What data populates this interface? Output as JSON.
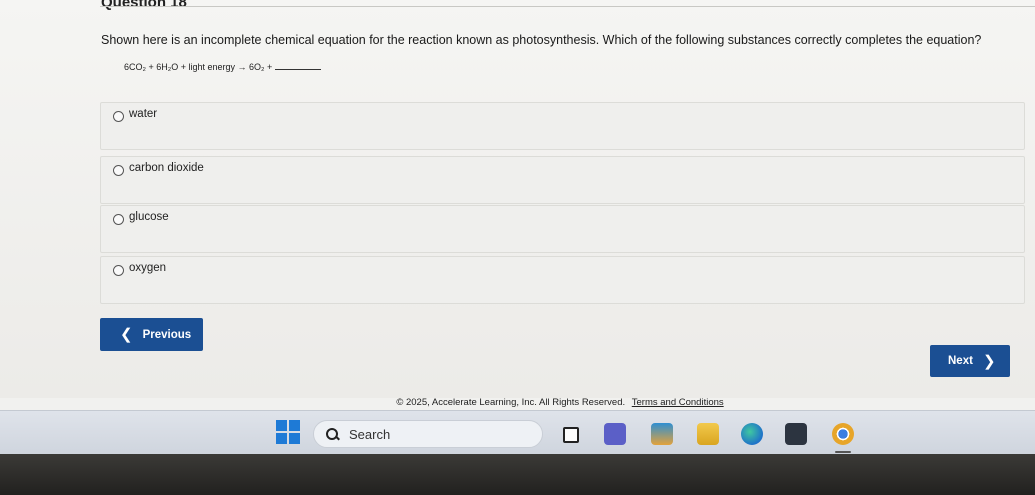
{
  "question": {
    "title": "Question 18",
    "text": "Shown here is an incomplete chemical equation for the reaction known as photosynthesis. Which of the following substances correctly completes the equation?",
    "equation": "6CO₂ + 6H₂O + light energy → 6O₂ +"
  },
  "options": [
    {
      "label": "water"
    },
    {
      "label": "carbon dioxide"
    },
    {
      "label": "glucose"
    },
    {
      "label": "oxygen"
    }
  ],
  "nav": {
    "previous_label": "Previous",
    "next_label": "Next"
  },
  "footer": {
    "copyright": "© 2025, Accelerate Learning, Inc. All Rights Reserved.",
    "terms_link": "Terms and Conditions"
  },
  "taskbar": {
    "search_label": "Search",
    "apps": [
      "file-icon",
      "teams-icon",
      "weather-icon",
      "file-explorer-icon",
      "edge-icon",
      "store-icon",
      "chrome-icon"
    ]
  },
  "colors": {
    "primary_button": "#1b4f93",
    "windows_blue": "#1e7ad6"
  }
}
